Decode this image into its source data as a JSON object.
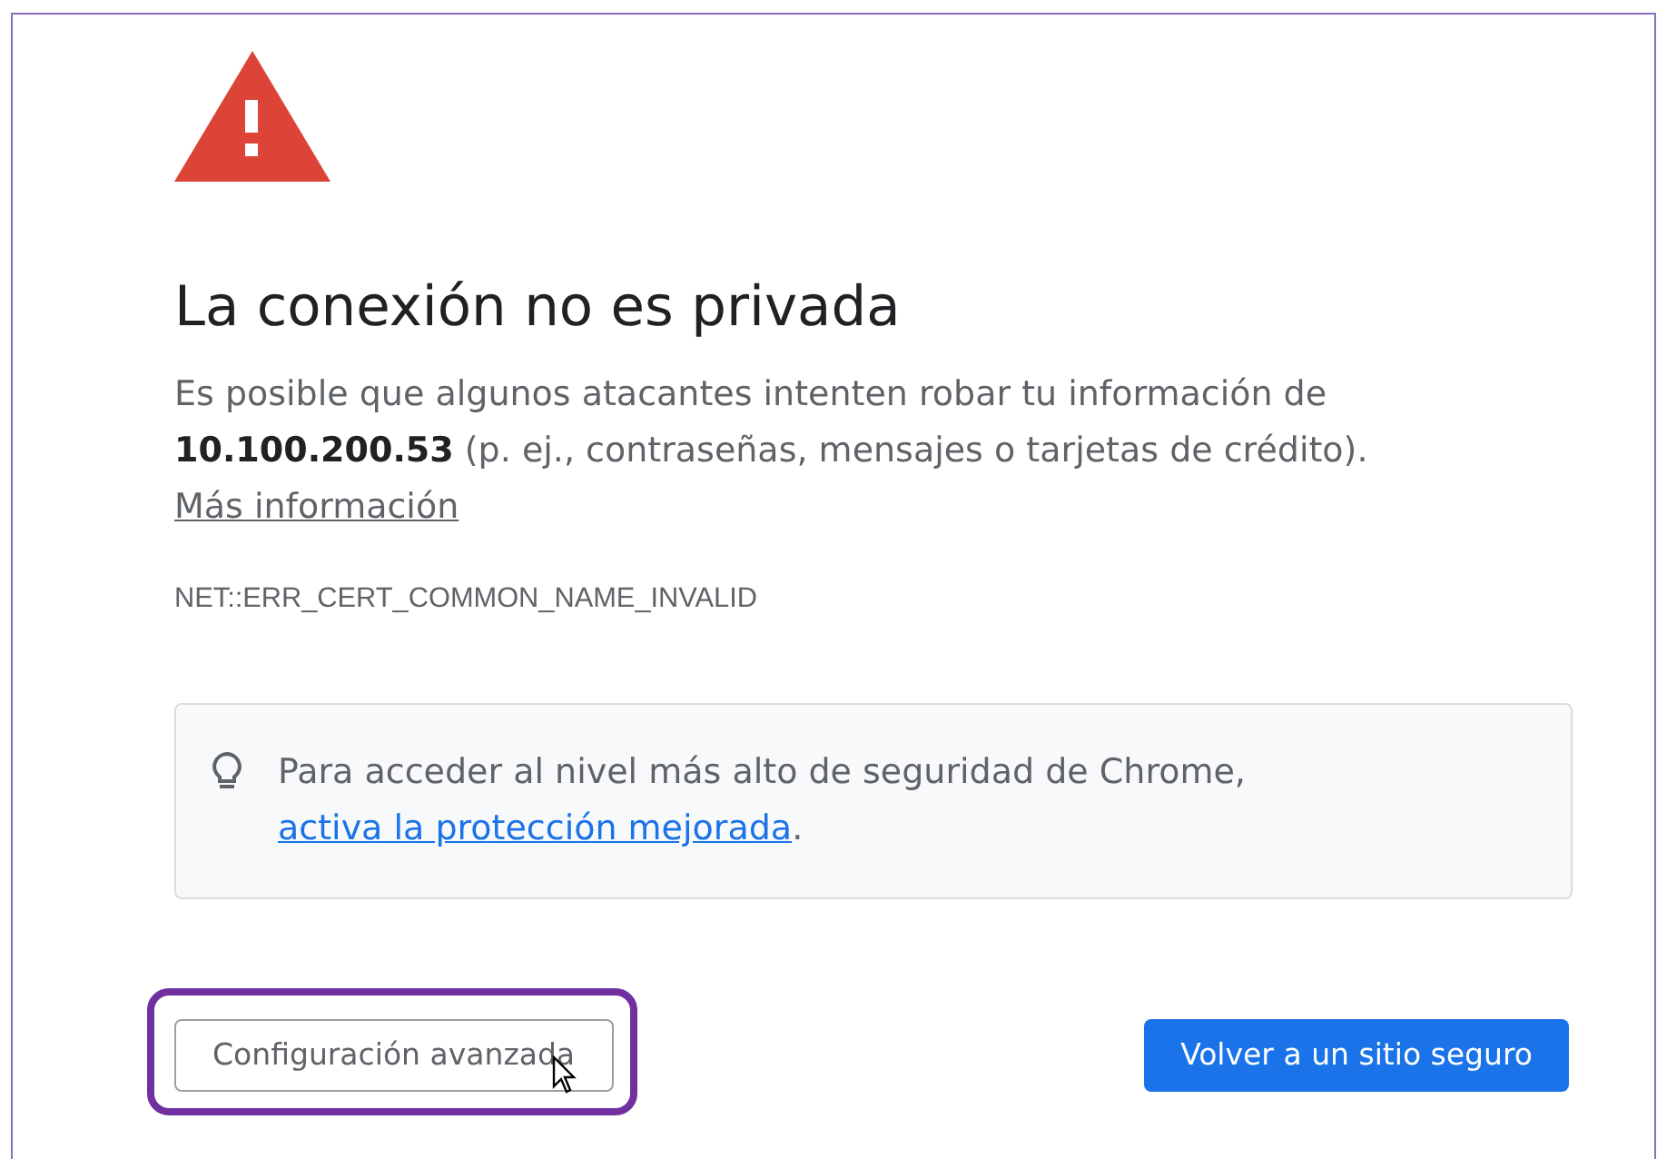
{
  "title": "La conexión no es privada",
  "description": {
    "text": "Es posible que algunos atacantes intenten robar tu información de **10.100.200.53** (p. ej., contraseñas, mensajes o tarjetas de crédito).",
    "link": "Más información"
  },
  "error_code": "NET::ERR_CERT_COMMON_NAME_INVALID",
  "tip": {
    "text": "Para acceder al nivel más alto de seguridad de Chrome,",
    "link": "activa la protección mejorada",
    "suffix": "."
  },
  "buttons": [
    {
      "label": "Configuración avanzada",
      "kind": "secondary",
      "highlighted": true,
      "pointer": true
    },
    {
      "label": "Volver a un sitio seguro",
      "kind": "primary",
      "highlighted": false,
      "pointer": false
    }
  ]
}
